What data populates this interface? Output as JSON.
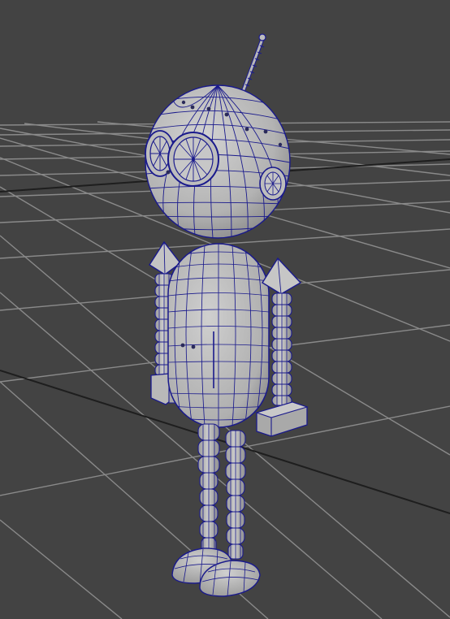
{
  "viewport": {
    "background": "#434343",
    "grid_color": "#8a8a8a",
    "grid_axis_color": "#1e1e1e",
    "wire_color": "#1a1a8c",
    "surface_color": "#b4b4b4",
    "surface_light": "#c8c8c8",
    "surface_dark": "#8f8f8f"
  },
  "scene": {
    "object": "robot-model",
    "shading": "wireframe-on-shaded"
  }
}
